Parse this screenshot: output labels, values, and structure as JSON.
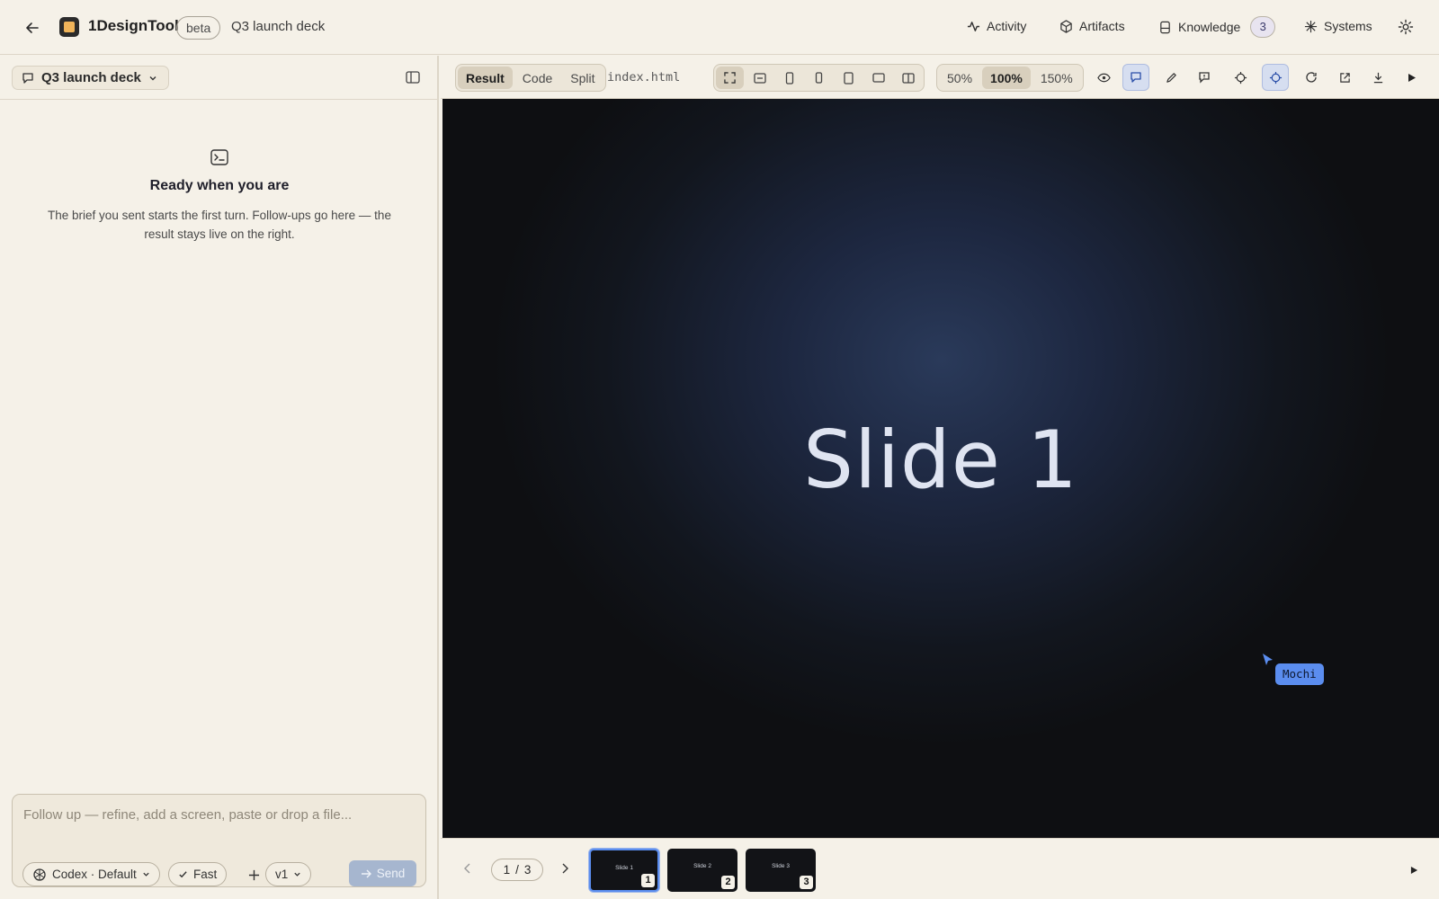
{
  "header": {
    "app_name": "1DesignTool",
    "badge": "beta",
    "document_title": "Q3 launch deck",
    "nav": {
      "activity": "Activity",
      "artifacts": "Artifacts",
      "knowledge": "Knowledge",
      "knowledge_count": "3",
      "systems": "Systems"
    }
  },
  "sidebar": {
    "session_name": "Q3 launch deck",
    "empty_title": "Ready when you are",
    "empty_desc": "The brief you sent starts the first turn. Follow-ups go here — the result stays live on the right.",
    "composer": {
      "placeholder": "Follow up — refine, add a screen, paste or drop a file...",
      "model": "Codex · Default",
      "speed": "Fast",
      "version": "v1",
      "send": "Send"
    }
  },
  "toolbar": {
    "view_tabs": [
      "Result",
      "Code",
      "Split"
    ],
    "active_view": "Result",
    "filename": "index.html",
    "zoom_options": [
      "50%",
      "100%",
      "150%"
    ],
    "active_zoom": "100%"
  },
  "preview": {
    "slide_title": "Slide 1",
    "cursor_label": "Mochi"
  },
  "slides_nav": {
    "current": "1",
    "separator": "/",
    "total": "3",
    "thumbnails": [
      {
        "label": "Slide 1",
        "num": "1"
      },
      {
        "label": "Slide 2",
        "num": "2"
      },
      {
        "label": "Slide 3",
        "num": "3"
      }
    ]
  },
  "colors": {
    "accent": "#5b8def",
    "background": "#f5f1e8",
    "slide_bg": "#0e0f12"
  }
}
